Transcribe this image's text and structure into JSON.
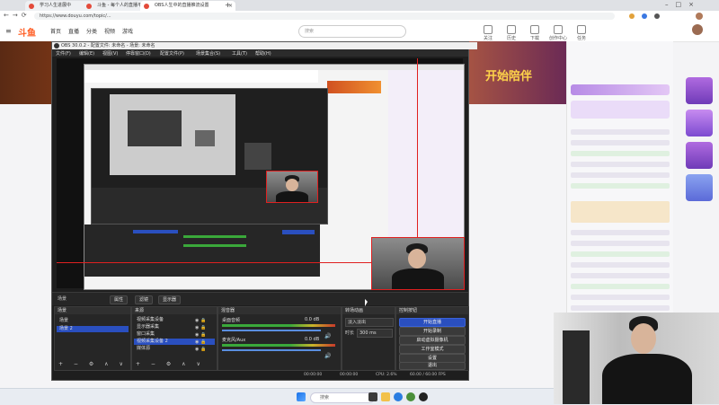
{
  "browser": {
    "tabs": [
      {
        "title": "学习人生进展中"
      },
      {
        "title": "斗鱼 - 每个人的直播平台"
      },
      {
        "title": "OBS人生中的直播推流设置"
      }
    ],
    "url": "https://www.douyu.com/topic/..."
  },
  "site": {
    "logo": "斗鱼",
    "nav": [
      "首页",
      "直播",
      "分类",
      "视频",
      "游戏"
    ],
    "search_placeholder": "搜索",
    "header_icons": [
      "关注",
      "历史",
      "下载",
      "创作中心",
      "任务"
    ],
    "live_button": "开播",
    "banner_text": "开始陪伴"
  },
  "obs": {
    "window_title": "OBS 30.0.2 - 配置文件: 未命名 - 场景: 未命名",
    "menu": [
      "文件(F)",
      "编辑(E)",
      "视图(V)",
      "停靠窗口(D)",
      "配置文件(P)",
      "场景集合(S)",
      "工具(T)",
      "帮助(H)"
    ],
    "toolbar": {
      "scene_label": "场景",
      "properties": "属性",
      "filters": "滤镜",
      "display": "显示器"
    },
    "scenes": {
      "header": "场景",
      "items": [
        "场景",
        "场景 2"
      ]
    },
    "sources": {
      "header": "来源",
      "items": [
        "视频采集设备",
        "显示器采集",
        "窗口采集",
        "视频采集设备 2",
        "媒体源"
      ]
    },
    "mixer": {
      "header": "混音器",
      "channels": [
        "桌面音频",
        "麦克风/Aux"
      ],
      "levels": [
        "0.0 dB",
        "0.0 dB"
      ]
    },
    "transitions": {
      "header": "转场动画",
      "type": "淡入淡出",
      "duration_label": "时长",
      "duration": "300 ms"
    },
    "controls": {
      "header": "控制按钮",
      "buttons": [
        "开始直播",
        "开始录制",
        "启动虚拟摄像机",
        "工作室模式",
        "设置",
        "退出"
      ]
    },
    "status": {
      "fps": "60.00 / 60.00 FPS",
      "cpu": "CPU: 2.6%",
      "time1": "00:00:00",
      "time2": "00:00:00"
    }
  },
  "taskbar": {
    "search": "搜索"
  },
  "colors": {
    "accent": "#2a4fbf",
    "brand": "#ff6a3d",
    "selection_red": "#e02020"
  }
}
